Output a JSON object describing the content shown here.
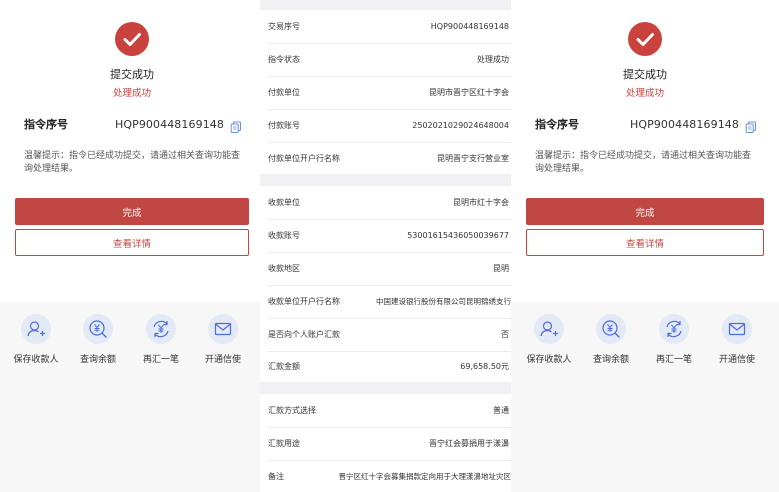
{
  "left": {
    "success_title": "提交成功",
    "success_sub": "处理成功",
    "seq_label": "指令序号",
    "seq_value": "HQP900448169148",
    "tip": "温馨提示：指令已经成功提交，请通过相关查询功能查询处理结果。",
    "btn_done": "完成",
    "btn_detail": "查看详情",
    "actions": [
      {
        "label": "保存收款人",
        "icon": "add-user-icon"
      },
      {
        "label": "查询余额",
        "icon": "yen-search-icon"
      },
      {
        "label": "再汇一笔",
        "icon": "yen-refresh-icon"
      },
      {
        "label": "开通信使",
        "icon": "mail-icon"
      }
    ]
  },
  "middle": {
    "group1": [
      {
        "label": "交易序号",
        "value": "HQP900448169148"
      },
      {
        "label": "指令状态",
        "value": "处理成功"
      },
      {
        "label": "付款单位",
        "value": "昆明市晋宁区红十字会"
      },
      {
        "label": "付款账号",
        "value": "2502021029024648004"
      },
      {
        "label": "付款单位开户行名称",
        "value": "昆明晋宁支行营业室"
      }
    ],
    "group2": [
      {
        "label": "收款单位",
        "value": "昆明市红十字会"
      },
      {
        "label": "收款账号",
        "value": "53001615436050039677"
      },
      {
        "label": "收款地区",
        "value": "昆明"
      },
      {
        "label": "收款单位开户行名称",
        "value": "中国建设银行股份有限公司昆明锦绣支行"
      },
      {
        "label": "是否向个人账户汇款",
        "value": "否"
      },
      {
        "label": "汇款金额",
        "value": "69,658.50元"
      }
    ],
    "group3": [
      {
        "label": "汇款方式选择",
        "value": "普通"
      },
      {
        "label": "汇款用途",
        "value": "晋宁红会募捐用于漾濞"
      },
      {
        "label": "备注",
        "value": "晋宁区红十字会募集捐款定向用于大理漾濞地址灾区"
      }
    ]
  },
  "right": {
    "success_title": "提交成功",
    "success_sub": "处理成功",
    "seq_label": "指令序号",
    "seq_value": "HQP900448169148",
    "tip": "温馨提示：指令已经成功提交，请通过相关查询功能查询处理结果。",
    "btn_done": "完成",
    "btn_detail": "查看详情",
    "actions": [
      {
        "label": "保存收款人",
        "icon": "add-user-icon"
      },
      {
        "label": "查询余额",
        "icon": "yen-search-icon"
      },
      {
        "label": "再汇一笔",
        "icon": "yen-refresh-icon"
      },
      {
        "label": "开通信使",
        "icon": "mail-icon"
      }
    ]
  },
  "colors": {
    "accent": "#c9423d",
    "icon_bg": "#e3e9f6",
    "icon_stroke": "#4a6fd8"
  }
}
